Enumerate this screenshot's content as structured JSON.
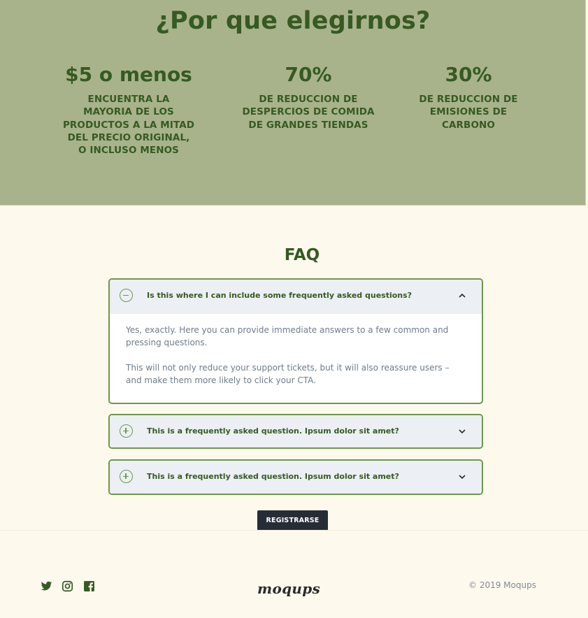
{
  "why": {
    "title": "¿Por que elegirnos?",
    "stats": [
      {
        "value": "$5 o menos",
        "description": "ENCUENTRA LA MAYORIA DE LOS PRODUCTOS A LA MITAD DEL PRECIO ORIGINAL, O INCLUSO MENOS"
      },
      {
        "value": "70%",
        "description": "DE REDUCCION DE DESPERCIOS DE COMIDA DE GRANDES TIENDAS"
      },
      {
        "value": "30%",
        "description": "DE REDUCCION DE EMISIONES DE CARBONO"
      }
    ]
  },
  "faq": {
    "title": "FAQ",
    "items": [
      {
        "question": "Is this where I can include some frequently asked questions?",
        "expanded": true,
        "answer": [
          "Yes, exactly. Here you can provide immediate answers to a few common and pressing questions.",
          "This will not only reduce your support tickets, but it will also reassure users – and make them more likely to click your CTA."
        ]
      },
      {
        "question": "This is a frequently asked question. Ipsum dolor sit amet?",
        "expanded": false
      },
      {
        "question": "This is a frequently asked question. Ipsum dolor sit amet?",
        "expanded": false
      }
    ]
  },
  "cta": {
    "label": "REGISTRARSE"
  },
  "footer": {
    "social_icons": [
      "twitter-icon",
      "instagram-icon",
      "facebook-icon"
    ],
    "logo": "moqups",
    "copyright": "© 2019  Moqups"
  },
  "colors": {
    "hero_bg": "#a8b38b",
    "page_bg": "#fdf9ec",
    "accent_green": "#355a22",
    "border_green": "#6a9a4a",
    "button_dark": "#272d36"
  }
}
